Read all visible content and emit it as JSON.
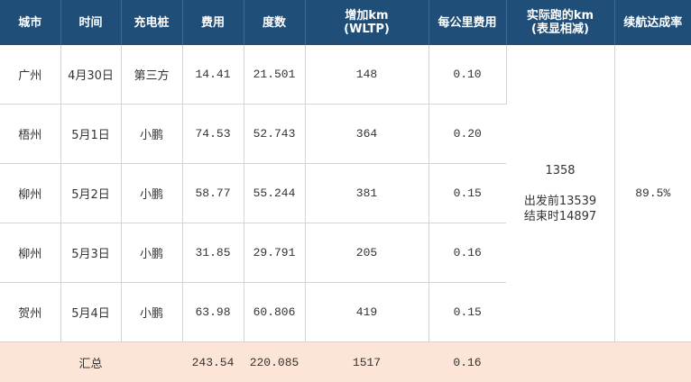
{
  "headers": {
    "city": "城市",
    "time": "时间",
    "charger": "充电桩",
    "cost": "费用",
    "kwh": "度数",
    "added_km_line1": "增加km",
    "added_km_line2": "(WLTP)",
    "cost_per_km": "每公里费用",
    "actual_km_line1": "实际跑的km",
    "actual_km_line2": "(表显相减)",
    "range_rate": "续航达成率"
  },
  "rows": [
    {
      "city": "广州",
      "date": "4月30日",
      "charger": "第三方",
      "cost": "14.41",
      "kwh": "21.501",
      "km": "148",
      "per_km": "0.10"
    },
    {
      "city": "梧州",
      "date": "5月1日",
      "charger": "小鹏",
      "cost": "74.53",
      "kwh": "52.743",
      "km": "364",
      "per_km": "0.20"
    },
    {
      "city": "柳州",
      "date": "5月2日",
      "charger": "小鹏",
      "cost": "58.77",
      "kwh": "55.244",
      "km": "381",
      "per_km": "0.15"
    },
    {
      "city": "柳州",
      "date": "5月3日",
      "charger": "小鹏",
      "cost": "31.85",
      "kwh": "29.791",
      "km": "205",
      "per_km": "0.16"
    },
    {
      "city": "贺州",
      "date": "5月4日",
      "charger": "小鹏",
      "cost": "63.98",
      "kwh": "60.806",
      "km": "419",
      "per_km": "0.15"
    }
  ],
  "actual": {
    "km": "1358",
    "start": "出发前13539",
    "end": "结束时14897"
  },
  "range_rate": "89.5%",
  "total": {
    "label": "汇总",
    "cost": "243.54",
    "kwh": "220.085",
    "km": "1517",
    "per_km": "0.16"
  }
}
